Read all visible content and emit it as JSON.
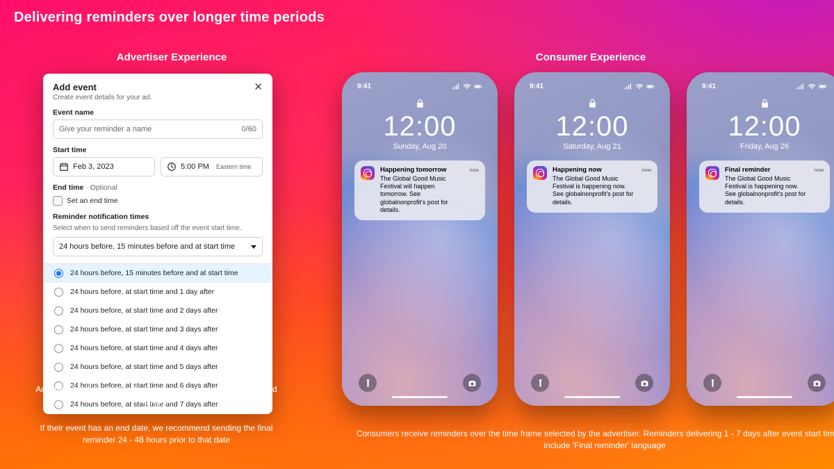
{
  "page_title": "Delivering reminders over longer time periods",
  "sections": {
    "advertiser": "Advertiser Experience",
    "consumer": "Consumer Experience"
  },
  "card": {
    "title": "Add event",
    "subtitle": "Create event details for your ad.",
    "event_name_label": "Event name",
    "event_name_placeholder": "Give your reminder a name",
    "event_name_counter": "0/60",
    "start_time_label": "Start time",
    "start_date": "Feb 3, 2023",
    "start_time": "5:00 PM",
    "timezone": "Eastern time",
    "end_time_label": "End time",
    "end_time_optional": "· Optional",
    "end_time_checkbox": "Set an end time",
    "reminder_label": "Reminder notification times",
    "reminder_helper": "Select when to send reminders based off the event start time.",
    "reminder_selected": "24 hours before, 15 minutes before and at start time",
    "options": [
      "24 hours before, 15 minutes before and at start time",
      "24 hours before, at start time and 1 day after",
      "24 hours before, at start time and 2 days after",
      "24 hours before, at start time and 3 days after",
      "24 hours before, at start time and 4 days after",
      "24 hours before, at start time and 5 days after",
      "24 hours before, at start time and 6 days after",
      "24 hours before, at start time and 7 days after"
    ]
  },
  "adv_copy_1": "Advertisers select their preferred time frame over which to remind people",
  "adv_copy_2": "If their event has an end date, we recommend sending the final reminder 24 - 48 hours prior to that date",
  "con_copy": "Consumers receive reminders over the time frame selected by the advertiser.  Reminders delivering 1 - 7 days after event start time will include 'Final reminder' language",
  "phones": [
    {
      "time": "9:41",
      "clock": "12:00",
      "date": "Sunday, Aug 20",
      "notif_title": "Happening tomorrow",
      "notif_body": "The Global Good Music Festival will happen tomorrow. See globalnonprofit's post for details.",
      "notif_time": "now"
    },
    {
      "time": "9:41",
      "clock": "12:00",
      "date": "Saturday, Aug 21",
      "notif_title": "Happening now",
      "notif_body": "The Global Good Music Festival is happening now. See globalnonprofit's post for details.",
      "notif_time": "now"
    },
    {
      "time": "9:41",
      "clock": "12:00",
      "date": "Friday, Aug 26",
      "notif_title": "Final reminder",
      "notif_body": "The Global Good Music Festival is happening now. See globalnonprofit's post for details.",
      "notif_time": "now"
    }
  ]
}
